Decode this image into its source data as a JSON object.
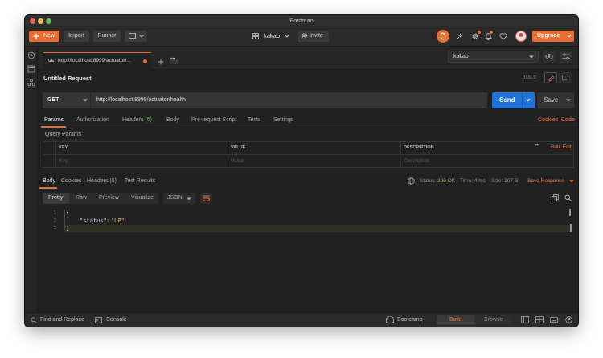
{
  "window": {
    "title": "Postman"
  },
  "toolbar": {
    "new_label": "New",
    "import_label": "Import",
    "runner_label": "Runner",
    "workspace_name": "kakao",
    "invite_label": "Invite",
    "upgrade_label": "Upgrade"
  },
  "tabs": [
    {
      "method": "GET",
      "label": "http://localhost:8999/actuator/..."
    }
  ],
  "environment": {
    "selected": "kakao"
  },
  "request": {
    "name": "Untitled Request",
    "build_label": "BUILD",
    "method": "GET",
    "url": "http://localhost:8999/actuator/health",
    "send_label": "Send",
    "save_label": "Save"
  },
  "request_tabs": {
    "params": "Params",
    "authorization": "Authorization",
    "headers": "Headers",
    "headers_count": "(6)",
    "body": "Body",
    "prerequest": "Pre-request Script",
    "tests": "Tests",
    "settings": "Settings",
    "cookies": "Cookies",
    "code": "Code"
  },
  "query_params": {
    "title": "Query Params",
    "col_key": "KEY",
    "col_value": "VALUE",
    "col_description": "DESCRIPTION",
    "bulk_edit": "Bulk Edit",
    "more": "•••",
    "key_placeholder": "Key",
    "value_placeholder": "Value",
    "description_placeholder": "Description"
  },
  "response_tabs": {
    "body": "Body",
    "cookies": "Cookies",
    "headers": "Headers",
    "headers_count": "(5)",
    "test_results": "Test Results"
  },
  "response_meta": {
    "status_label": "Status:",
    "status_value": "200 OK",
    "time_label": "Time:",
    "time_value": "4 ms",
    "size_label": "Size:",
    "size_value": "207 B",
    "save_response": "Save Response"
  },
  "view_modes": {
    "pretty": "Pretty",
    "raw": "Raw",
    "preview": "Preview",
    "visualize": "Visualize",
    "format": "JSON"
  },
  "response_body": {
    "line_numbers": [
      "1",
      "2",
      "3"
    ],
    "open_brace": "{",
    "key": "\"status\"",
    "colon": ":",
    "value": "\"UP\"",
    "close_brace": "}"
  },
  "statusbar": {
    "find_replace": "Find and Replace",
    "console": "Console",
    "bootcamp": "Bootcamp",
    "build": "Build",
    "browse": "Browse"
  },
  "colors": {
    "accent": "#ea6d34",
    "send_blue": "#1f72d8",
    "status_green": "#78b96c",
    "json_string": "#e0b27a",
    "json_key": "#cfe3f5"
  },
  "icons": [
    "plus-icon",
    "chevron-down-icon",
    "workspace-grid-icon",
    "add-person-icon",
    "sync-icon",
    "satellite-icon",
    "gear-icon",
    "bell-icon",
    "heart-icon",
    "avatar",
    "history-icon",
    "collection-icon",
    "api-icon",
    "close-tab-icon",
    "more-dots-icon",
    "eye-icon",
    "sliders-icon",
    "pencil-icon",
    "comment-icon",
    "globe-icon",
    "copy-icon",
    "search-icon",
    "wrap-lines-icon",
    "bootcamp-icon",
    "two-pane-icon",
    "layout-icon",
    "keyboard-icon",
    "help-icon"
  ]
}
